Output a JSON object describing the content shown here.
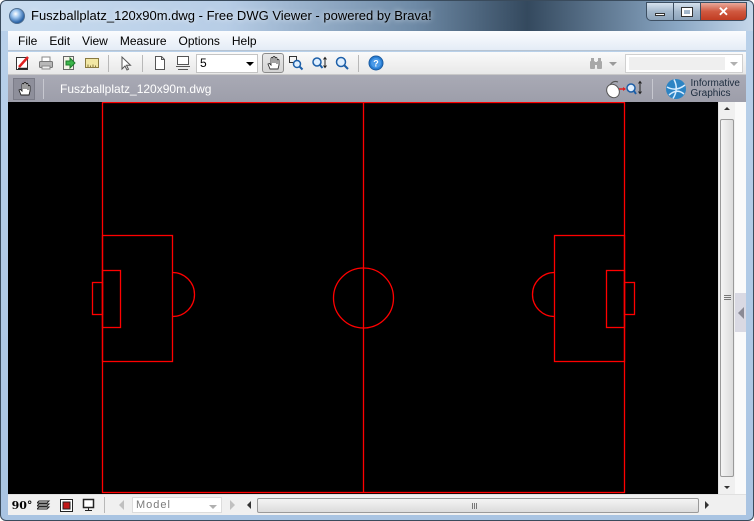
{
  "window": {
    "title": "Fuszballplatz_120x90m.dwg - Free DWG Viewer - powered by Brava!",
    "caption_buttons": {
      "minimize": "minimize",
      "maximize": "maximize",
      "close": "✕"
    }
  },
  "menubar": {
    "items": [
      {
        "label": "File"
      },
      {
        "label": "Edit"
      },
      {
        "label": "View"
      },
      {
        "label": "Measure"
      },
      {
        "label": "Options"
      },
      {
        "label": "Help"
      }
    ]
  },
  "toolbar": {
    "buttons": [
      {
        "name": "markup-icon"
      },
      {
        "name": "print-icon"
      },
      {
        "name": "export-icon"
      },
      {
        "name": "measure-icon"
      },
      {
        "name": "select-pointer-icon"
      },
      {
        "name": "page-icon"
      },
      {
        "name": "page-setup-icon"
      },
      {
        "name": "pan-hand-icon",
        "active": true
      },
      {
        "name": "zoom-window-icon"
      },
      {
        "name": "zoom-dynamic-icon"
      },
      {
        "name": "zoom-extents-icon"
      },
      {
        "name": "help-icon"
      }
    ],
    "page_select_value": "5",
    "search_value": ""
  },
  "docbar": {
    "document_name": "Fuszballplatz_120x90m.dwg",
    "brand_line1": "Informative",
    "brand_line2": "Graphics"
  },
  "drawing": {
    "background": "#000000",
    "line_color": "#ff0000",
    "description": "Football pitch 120x90m"
  },
  "statusbar": {
    "rotate_label": "90°",
    "layout_select_value": "Model"
  }
}
